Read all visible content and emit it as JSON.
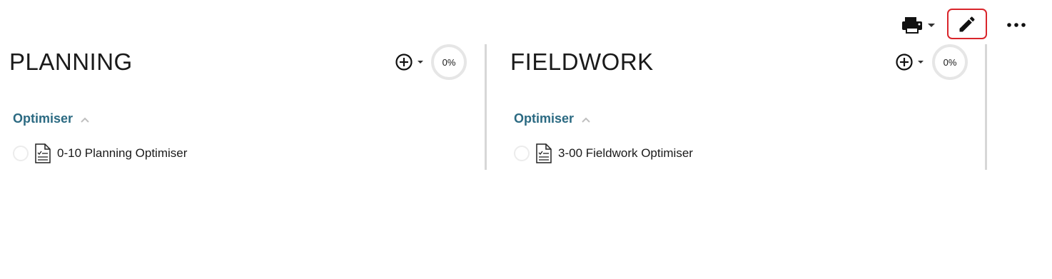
{
  "toolbar": {
    "print_icon": "printer-icon",
    "edit_icon": "pencil-icon",
    "more_icon": "more-horizontal-icon",
    "edit_highlight_color": "#d9252b"
  },
  "columns": [
    {
      "title": "PLANNING",
      "progress": "0%",
      "progress_value": 0,
      "group": {
        "label": "Optimiser",
        "expanded": true
      },
      "items": [
        {
          "label": "0-10 Planning Optimiser",
          "completed": false
        }
      ]
    },
    {
      "title": "FIELDWORK",
      "progress": "0%",
      "progress_value": 0,
      "group": {
        "label": "Optimiser",
        "expanded": true
      },
      "items": [
        {
          "label": "3-00 Fieldwork Optimiser",
          "completed": false
        }
      ]
    }
  ],
  "colors": {
    "accent": "#2b6a82",
    "divider": "#d7d7d7",
    "text": "#1a1a1a"
  }
}
